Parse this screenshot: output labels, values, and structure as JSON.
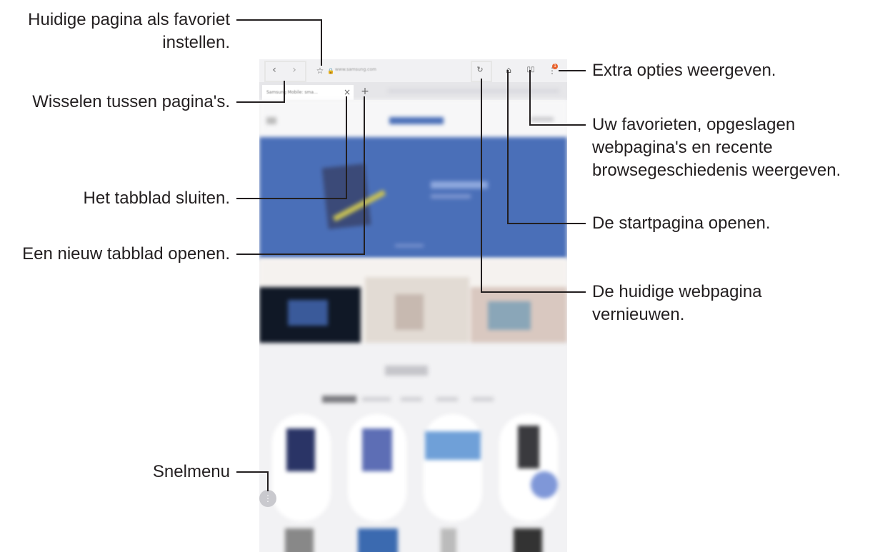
{
  "callouts": {
    "favorite": "Huidige pagina als favoriet instellen.",
    "switch": "Wisselen tussen pagina's.",
    "close_tab": "Het tabblad sluiten.",
    "new_tab": "Een nieuw tabblad openen.",
    "quick_menu": "Snelmenu",
    "more_options": "Extra opties weergeven.",
    "bookmarks": "Uw favorieten, opgeslagen webpagina's en recente browsegeschiedenis weergeven.",
    "home": "De startpagina openen.",
    "refresh": "De huidige webpagina vernieuwen."
  },
  "browser": {
    "url": "www.samsung.com",
    "tab_title": "Samsung Mobile: sma...",
    "notification_count": "1"
  },
  "colors": {
    "hero_blue": "#4a6fb8",
    "annotation_line": "#231f20",
    "badge": "#e8622c",
    "fab": "#7f97d8"
  }
}
